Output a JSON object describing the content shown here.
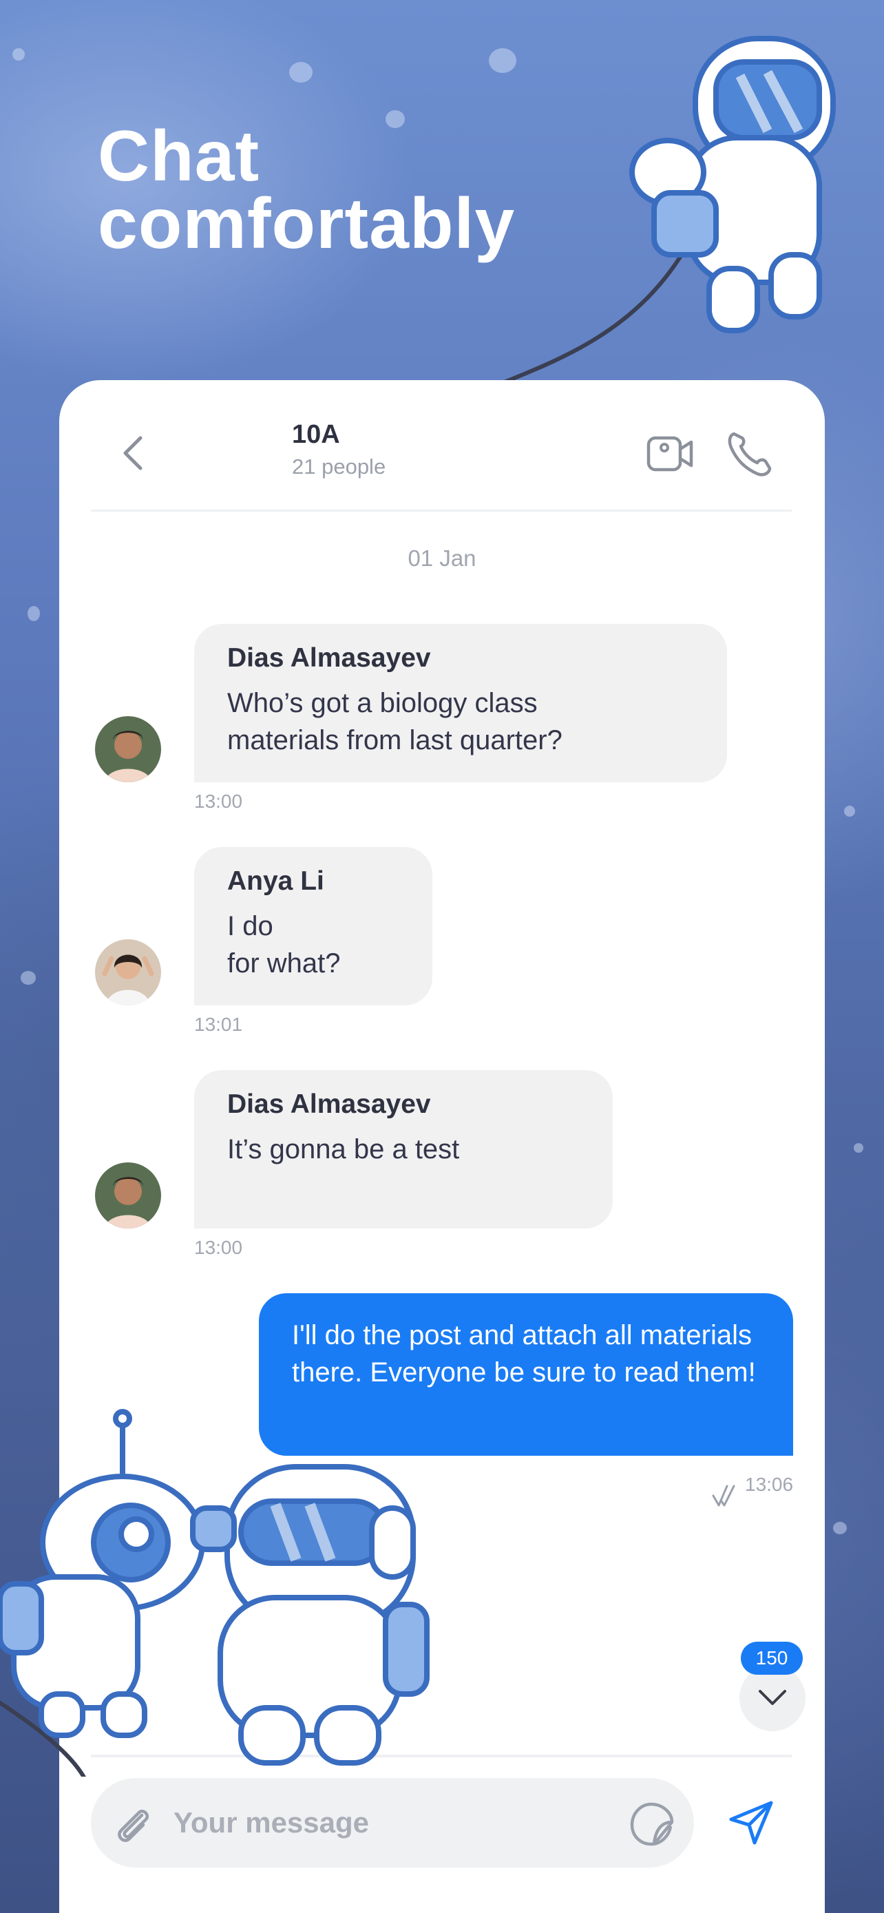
{
  "headline": {
    "line1": "Chat",
    "line2": "comfortably"
  },
  "chat": {
    "title": "10A",
    "subtitle": "21 people",
    "date": "01 Jan"
  },
  "messages": [
    {
      "sender": "Dias Almasayev",
      "text": "Who’s got a biology class\nmaterials from last quarter?",
      "time": "13:00"
    },
    {
      "sender": "Anya Li",
      "text": "I do\nfor what?",
      "time": "13:01"
    },
    {
      "sender": "Dias Almasayev",
      "text": "It’s gonna be a test",
      "time": "13:00"
    }
  ],
  "outgoing": {
    "text": "I'll do the post and attach all materials there. Everyone be sure to read them!",
    "time": "13:06"
  },
  "unread_badge": "150",
  "composer": {
    "placeholder": "Your message"
  },
  "colors": {
    "accent": "#1a7cf5",
    "bubble_in": "#f1f1f2",
    "background": "#5a79b8"
  }
}
